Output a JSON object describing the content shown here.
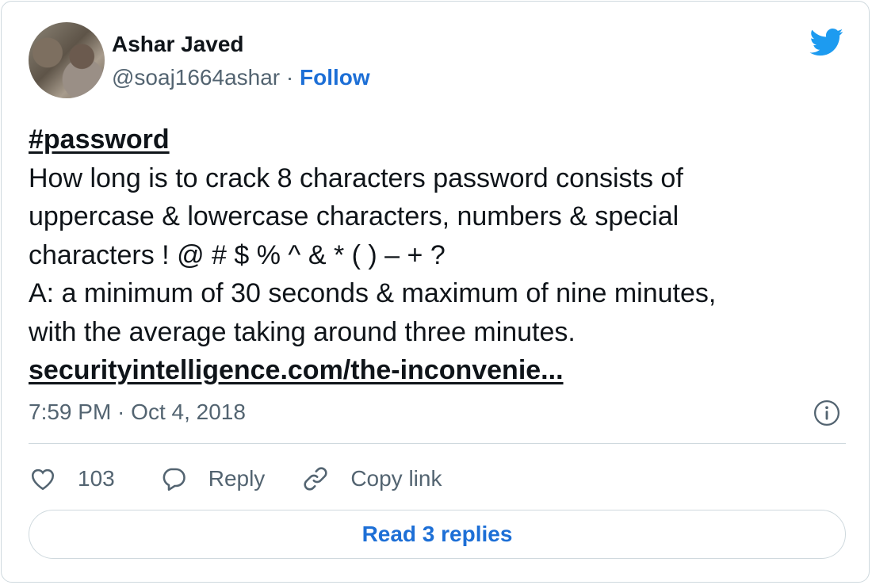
{
  "author": {
    "name": "Ashar Javed",
    "handle": "@soaj1664ashar",
    "separator": "·",
    "follow_label": "Follow"
  },
  "tweet": {
    "hashtag": "#password",
    "lines": [
      "How long is to crack 8 characters password consists of",
      "uppercase & lowercase characters, numbers & special",
      "characters ! @ # $ % ^ & * ( ) – + ?",
      "A: a minimum of 30 seconds & maximum of nine minutes,",
      "with the average taking around three minutes."
    ],
    "link_text": "securityintelligence.com/the-inconvenie..."
  },
  "meta": {
    "timestamp": "7:59 PM · Oct 4, 2018"
  },
  "actions": {
    "likes": "103",
    "reply_label": "Reply",
    "copy_label": "Copy link"
  },
  "read_replies_label": "Read 3 replies",
  "icons": {
    "brand": "twitter-bird-icon",
    "info": "info-icon",
    "like": "heart-icon",
    "reply": "speech-bubble-icon",
    "copy": "link-icon"
  },
  "colors": {
    "accent": "#1d9bf0",
    "link_blue": "#1d6fd6",
    "secondary_text": "#536471",
    "border": "#cfd9de"
  }
}
